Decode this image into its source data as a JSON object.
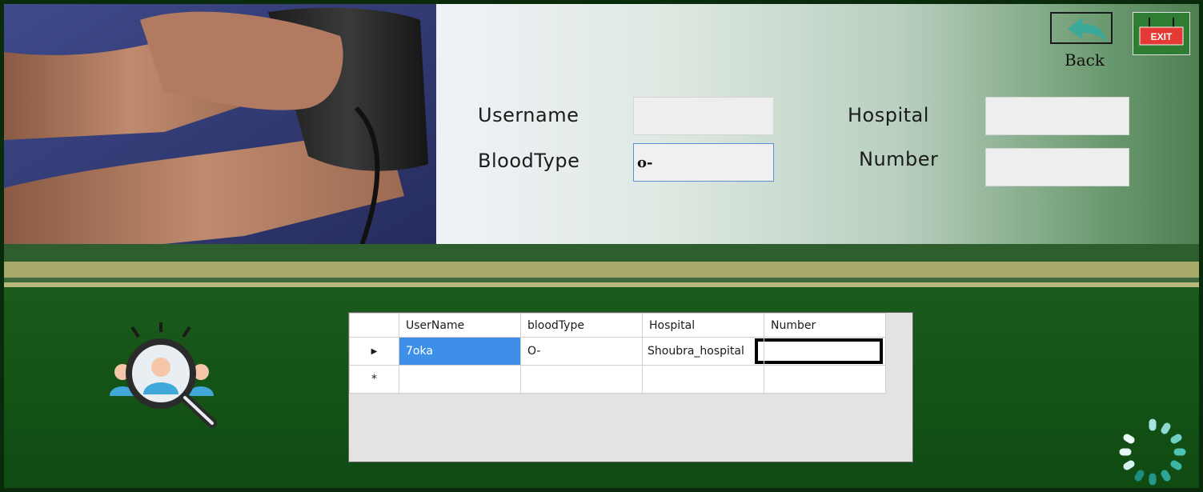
{
  "form": {
    "username_label": "Username",
    "username_value": "",
    "bloodtype_label": "BloodType",
    "bloodtype_value": "o-",
    "hospital_label": "Hospital",
    "hospital_value": "",
    "number_label": "Number",
    "number_value": ""
  },
  "toolbar": {
    "back_label": "Back",
    "exit_label": "EXIT"
  },
  "grid": {
    "columns": [
      "UserName",
      "bloodType",
      "Hospital",
      "Number"
    ],
    "rows": [
      {
        "username": "7oka",
        "bloodtype": "O-",
        "hospital": "Shoubra_hospital",
        "number": ""
      }
    ],
    "new_row_marker": "*",
    "current_row_marker": "▶"
  },
  "colors": {
    "accent_green": "#2e7d32",
    "selection_blue": "#3d8fe8",
    "back_arrow": "#3aa99a",
    "exit_red": "#e53935"
  },
  "icons": {
    "search": "user-search-icon",
    "loader": "loading-spinner-icon",
    "back": "back-arrow-icon",
    "exit": "exit-sign-icon"
  }
}
